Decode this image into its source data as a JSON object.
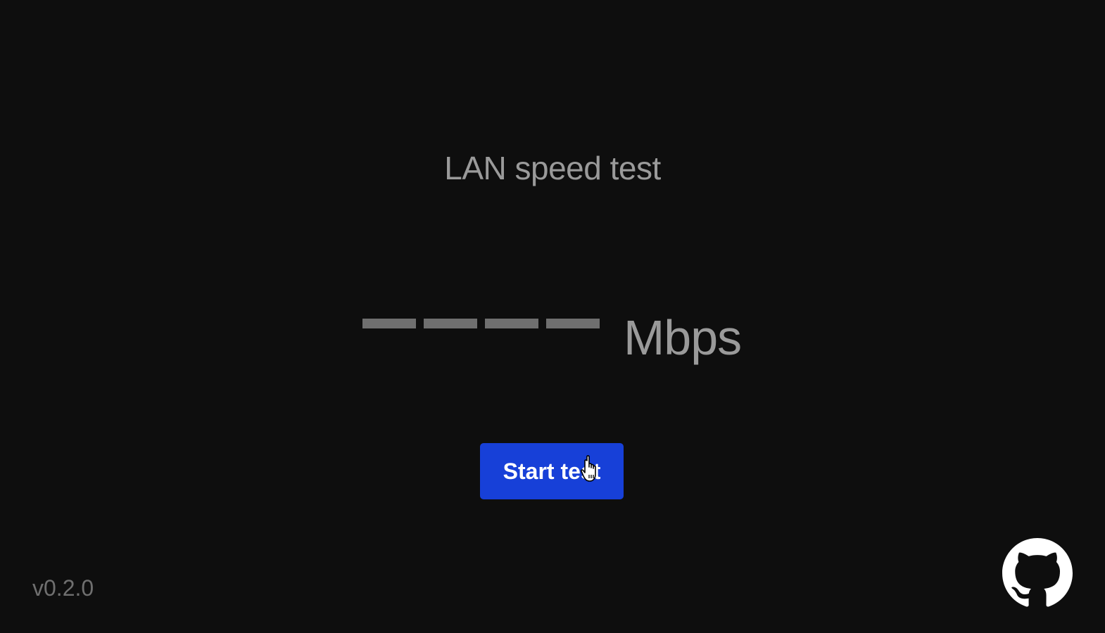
{
  "app": {
    "title": "LAN speed test"
  },
  "speed": {
    "value_placeholder": "————",
    "unit": "Mbps"
  },
  "actions": {
    "start_label": "Start test"
  },
  "footer": {
    "version": "v0.2.0",
    "github_icon": "github-icon"
  },
  "theme": {
    "background": "#0e0e0e",
    "accent": "#1740d8",
    "text_muted": "#9a9a9a",
    "dash_color": "#6f6f6f"
  }
}
